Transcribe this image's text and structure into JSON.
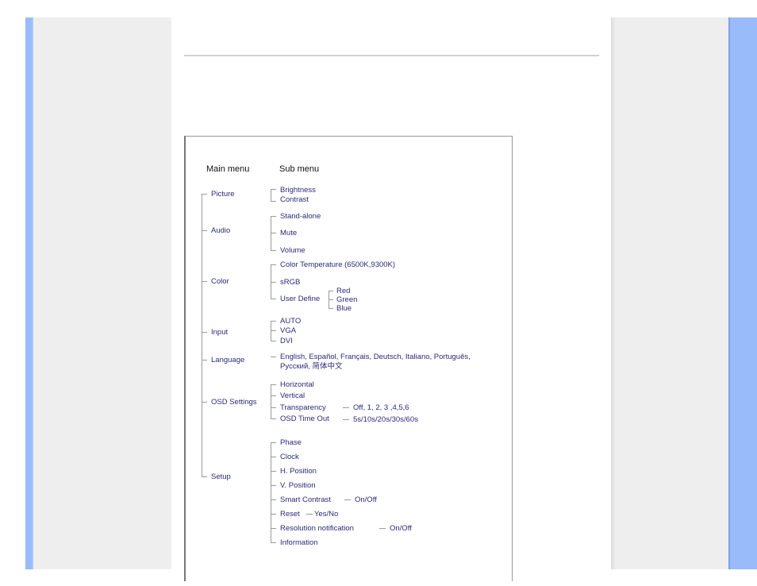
{
  "figure": {
    "headers": {
      "main": "Main menu",
      "sub": "Sub menu"
    },
    "main_items": [
      "Picture",
      "Audio",
      "Color",
      "Input",
      "Language",
      "OSD Settings",
      "Setup"
    ],
    "picture": [
      "Brightness",
      "Contrast"
    ],
    "audio": [
      "Stand-alone",
      "Mute",
      "Volume"
    ],
    "color": [
      "Color Temperature (6500K,9300K)",
      "sRGB",
      "User Define"
    ],
    "user_define": [
      "Red",
      "Green",
      "Blue"
    ],
    "input": [
      "AUTO",
      "VGA",
      "DVI"
    ],
    "language": [
      "English, Español, Français, Deutsch, Italiano, Português,",
      "Русский, 简体中文"
    ],
    "osd": [
      "Horizontal",
      "Vertical",
      "Transparency",
      "OSD Time Out"
    ],
    "osd_values": {
      "transparency": "Off, 1, 2, 3 ,4,5,6",
      "timeout": "5s/10s/20s/30s/60s"
    },
    "setup": [
      "Phase",
      "Clock",
      "H. Position",
      "V. Position",
      "Smart Contrast",
      "Reset",
      "Resolution notification",
      "Information"
    ],
    "setup_values": {
      "smart_contrast": "On/Off",
      "reset": "Yes/No",
      "resolution": "On/Off"
    }
  }
}
